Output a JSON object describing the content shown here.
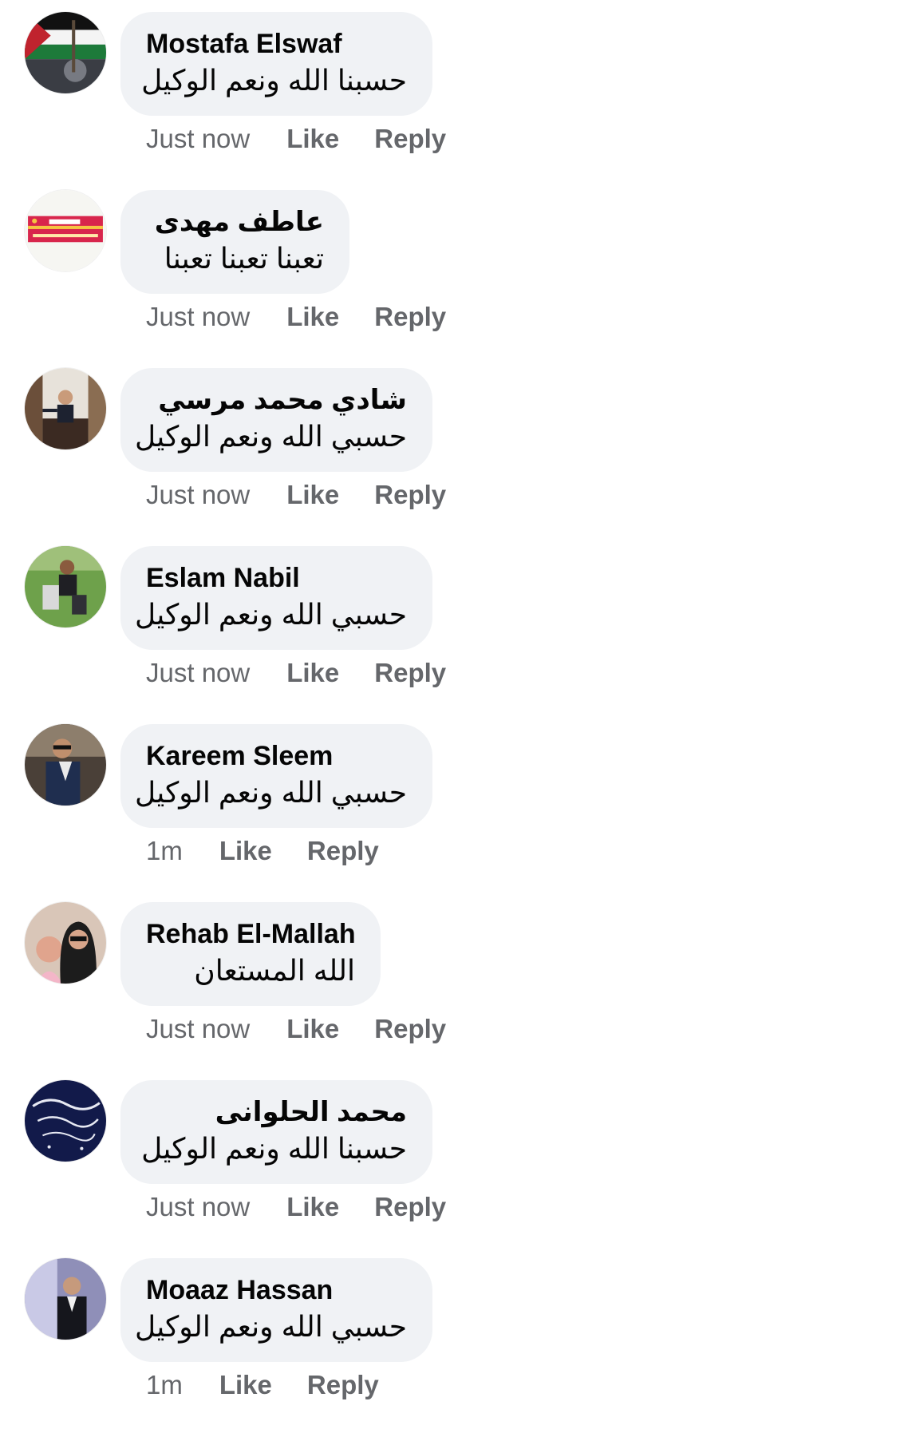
{
  "comments": [
    {
      "author": "Mostafa Elswaf",
      "text": "حسبنا الله ونعم الوكيل",
      "time": "Just now",
      "like": "Like",
      "reply": "Reply"
    },
    {
      "author": "عاطف مهدى",
      "text": "تعبنا تعبنا تعبنا",
      "time": "Just now",
      "like": "Like",
      "reply": "Reply"
    },
    {
      "author": "شادي محمد مرسي",
      "text": "حسبي الله ونعم الوكيل",
      "time": "Just now",
      "like": "Like",
      "reply": "Reply"
    },
    {
      "author": "Eslam Nabil",
      "text": "حسبي الله ونعم الوكيل",
      "time": "Just now",
      "like": "Like",
      "reply": "Reply"
    },
    {
      "author": "Kareem Sleem",
      "text": "حسبي الله ونعم الوكيل",
      "time": "1m",
      "like": "Like",
      "reply": "Reply"
    },
    {
      "author": "Rehab El-Mallah",
      "text": "الله المستعان",
      "time": "Just now",
      "like": "Like",
      "reply": "Reply"
    },
    {
      "author": "محمد الحلوانى",
      "text": "حسبنا الله ونعم الوكيل",
      "time": "Just now",
      "like": "Like",
      "reply": "Reply"
    },
    {
      "author": "Moaaz Hassan",
      "text": "حسبي الله ونعم الوكيل",
      "time": "1m",
      "like": "Like",
      "reply": "Reply"
    }
  ],
  "colors": {
    "bubble": "#f0f2f5",
    "meta_text": "#65676b",
    "primary_text": "#050505"
  }
}
